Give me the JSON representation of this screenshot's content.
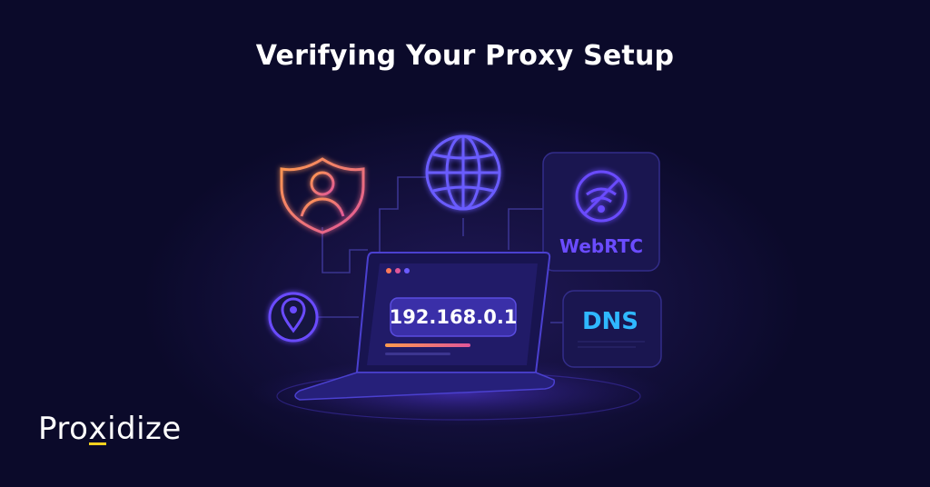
{
  "title": "Verifying Your Proxy Setup",
  "screen": {
    "ip_address": "192.168.0.1"
  },
  "cards": {
    "webrtc_label": "WebRTC",
    "dns_label": "DNS"
  },
  "brand": {
    "pre": "Pro",
    "x": "x",
    "post": "idize"
  },
  "colors": {
    "background": "#0b0a2a",
    "accent_purple": "#6b4cff",
    "dns_blue": "#2fb8ff",
    "brand_yellow": "#ffd21f",
    "orange": "#ff9a4d",
    "pink": "#e0569a"
  },
  "icons": [
    "user-shield-icon",
    "globe-icon",
    "wifi-off-icon",
    "location-pin-icon",
    "laptop-icon"
  ]
}
